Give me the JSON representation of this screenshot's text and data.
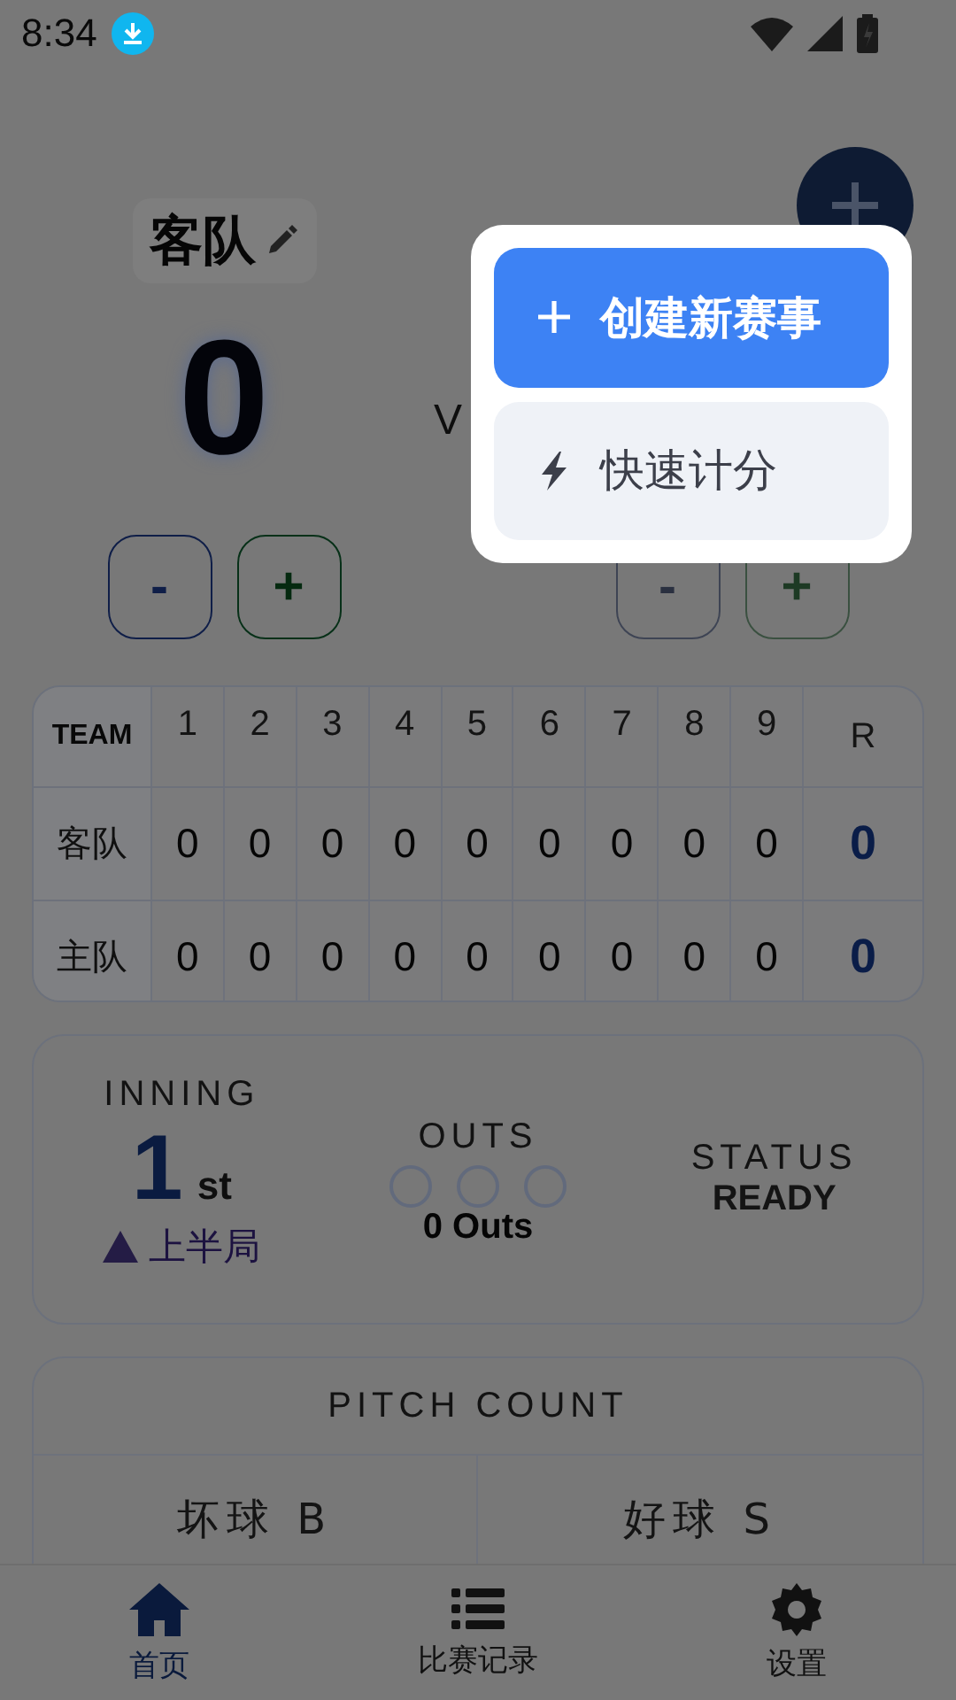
{
  "status_bar": {
    "time": "8:34"
  },
  "away": {
    "name": "客队",
    "score": "0",
    "buttons": [
      "-",
      "+"
    ]
  },
  "vs_text": "V",
  "home": {
    "buttons": [
      "-",
      "+"
    ]
  },
  "popup_menu": {
    "items": [
      {
        "label": "创建新赛事",
        "kind": "primary"
      },
      {
        "label": "快速计分",
        "kind": "secondary"
      }
    ]
  },
  "scoreboard": {
    "columns": [
      "TEAM",
      "1",
      "2",
      "3",
      "4",
      "5",
      "6",
      "7",
      "8",
      "9",
      "R"
    ],
    "rows": [
      {
        "team": "客队",
        "innings": [
          "0",
          "0",
          "0",
          "0",
          "0",
          "0",
          "0",
          "0",
          "0"
        ],
        "runs": "0"
      },
      {
        "team": "主队",
        "innings": [
          "0",
          "0",
          "0",
          "0",
          "0",
          "0",
          "0",
          "0",
          "0"
        ],
        "runs": "0"
      }
    ]
  },
  "inning": {
    "label": "INNING",
    "number": "1",
    "suffix": "st",
    "half": "上半局"
  },
  "outs": {
    "label": "OUTS",
    "dots": [
      {
        "filled": false
      },
      {
        "filled": false
      },
      {
        "filled": false
      }
    ],
    "text": "0 Outs"
  },
  "status": {
    "label": "STATUS",
    "value": "READY"
  },
  "pitch_count": {
    "title": "PITCH COUNT",
    "cells": [
      "坏球 B",
      "好球 S"
    ]
  },
  "bottom_nav": [
    {
      "label": "首页",
      "kind": "home",
      "selected": true
    },
    {
      "label": "比赛记录",
      "kind": "list",
      "selected": false
    },
    {
      "label": "设置",
      "kind": "settings",
      "selected": false
    }
  ]
}
